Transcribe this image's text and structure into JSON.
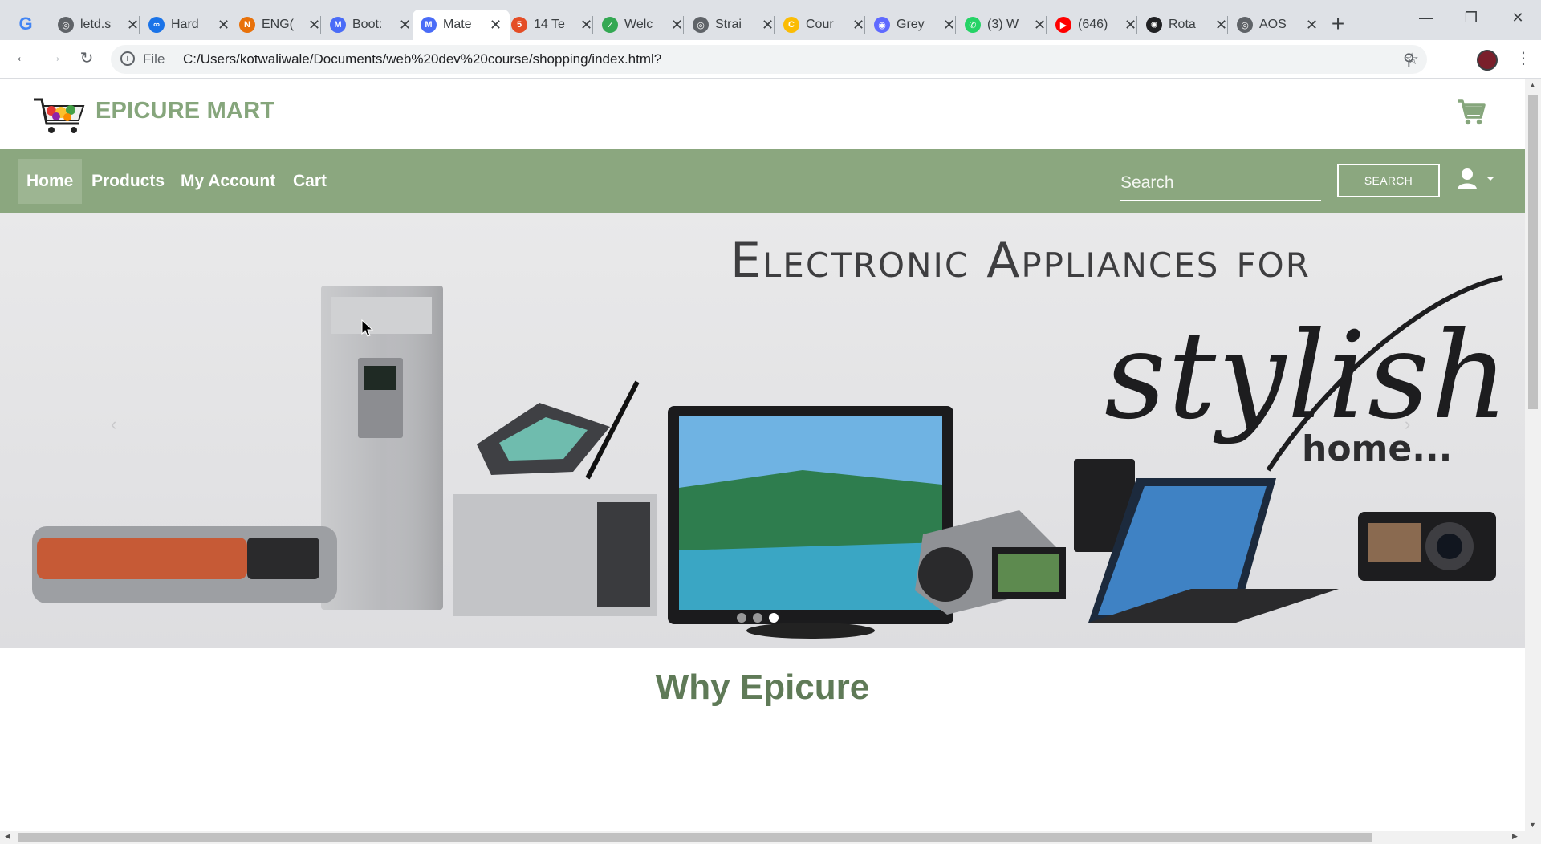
{
  "browser": {
    "tabs": [
      {
        "label": "letd.s",
        "color": "#5f6368",
        "glyph": "◎"
      },
      {
        "label": "Hard",
        "color": "#1a73e8",
        "glyph": "∞"
      },
      {
        "label": "ENG(",
        "color": "#e8710a",
        "glyph": "N"
      },
      {
        "label": "Boot:",
        "color": "#4a6cf7",
        "glyph": "M"
      },
      {
        "label": "Mate",
        "color": "#4a6cf7",
        "glyph": "M"
      },
      {
        "label": "14 Te",
        "color": "#e44d26",
        "glyph": "5"
      },
      {
        "label": "Welc",
        "color": "#34a853",
        "glyph": "✓"
      },
      {
        "label": "Strai",
        "color": "#5f6368",
        "glyph": "◎"
      },
      {
        "label": "Cour",
        "color": "#fbbc04",
        "glyph": "C"
      },
      {
        "label": "Grey",
        "color": "#5f6aff",
        "glyph": "◉"
      },
      {
        "label": "(3) W",
        "color": "#25d366",
        "glyph": "✆"
      },
      {
        "label": "(646)",
        "color": "#ff0000",
        "glyph": "▶"
      },
      {
        "label": "Rota",
        "color": "#202124",
        "glyph": "✺"
      },
      {
        "label": "AOS",
        "color": "#5f6368",
        "glyph": "◎"
      }
    ],
    "active_tab_index": 4,
    "address": {
      "scheme_label": "File",
      "url": "C:/Users/kotwaliwale/Documents/web%20dev%20course/shopping/index.html?"
    }
  },
  "site": {
    "brand": "EPICURE MART",
    "nav": {
      "home": "Home",
      "products": "Products",
      "account": "My Account",
      "cart": "Cart"
    },
    "search": {
      "placeholder": "Search",
      "button": "SEARCH"
    },
    "hero": {
      "line1": "Electronic Appliances for",
      "line2": "stylish",
      "line3": "home...",
      "slide_count": 3,
      "active_slide": 3
    },
    "section_title": "Why Epicure"
  },
  "colors": {
    "brand_green": "#86a67c",
    "navbar": "#8ba77f",
    "heading": "#5f7a57"
  }
}
